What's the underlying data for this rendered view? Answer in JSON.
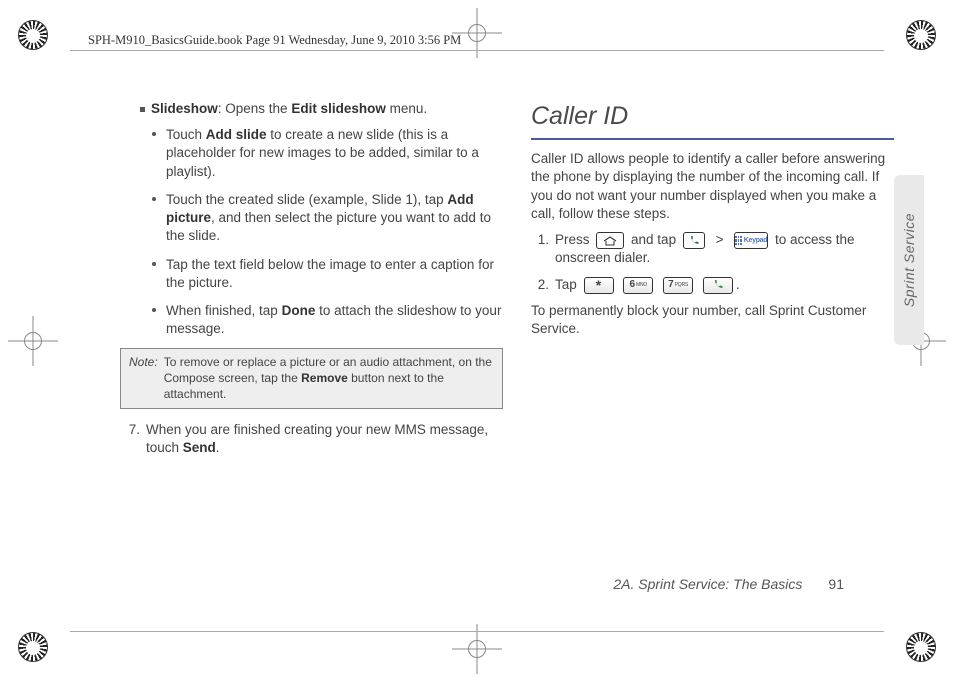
{
  "meta": {
    "header": "SPH-M910_BasicsGuide.book  Page 91  Wednesday, June 9, 2010  3:56 PM"
  },
  "left": {
    "slideshow_label": "Slideshow",
    "slideshow_rest": ": Opens the ",
    "slideshow_bold2": "Edit slideshow",
    "slideshow_rest2": " menu.",
    "b1_a": "Touch ",
    "b1_bold": "Add slide",
    "b1_b": " to create a new slide (this is a placeholder for new images to be added, similar to a playlist).",
    "b2_a": "Touch the created slide (example, Slide 1), tap ",
    "b2_bold": "Add picture",
    "b2_b": ", and then select the picture you want to add to the slide.",
    "b3": "Tap the text field below the image to enter a caption for the picture.",
    "b4_a": "When finished, tap ",
    "b4_bold": "Done",
    "b4_b": " to attach the slideshow to your message.",
    "note_label": "Note:",
    "note_a": "To remove or replace a picture or an audio attachment, on the Compose screen, tap the ",
    "note_bold": "Remove",
    "note_b": " button next to the attachment.",
    "s7_n": "7.",
    "s7_a": "When you are finished creating your new MMS message, touch ",
    "s7_bold": "Send",
    "s7_b": "."
  },
  "right": {
    "title": "Caller ID",
    "intro": "Caller ID allows people to identify a caller before answering the phone by displaying the number of the incoming call. If you do not want your number displayed when you make a call, follow these steps.",
    "s1_n": "1.",
    "s1_a": "Press ",
    "s1_b": " and tap ",
    "s1_gt": ">",
    "s1_c": " to access the onscreen dialer.",
    "keypad_label": "Keypad",
    "s2_n": "2.",
    "s2_a": "Tap ",
    "k_star": "*",
    "k_6": "6",
    "k_6_sub": "MNO",
    "k_7": "7",
    "k_7_sub": "PQRS",
    "s2_end": ".",
    "outro": "To permanently block your number, call Sprint Customer Service."
  },
  "footer": {
    "chapter": "2A. Sprint Service: The Basics",
    "page": "91"
  },
  "sidetab": "Sprint Service"
}
